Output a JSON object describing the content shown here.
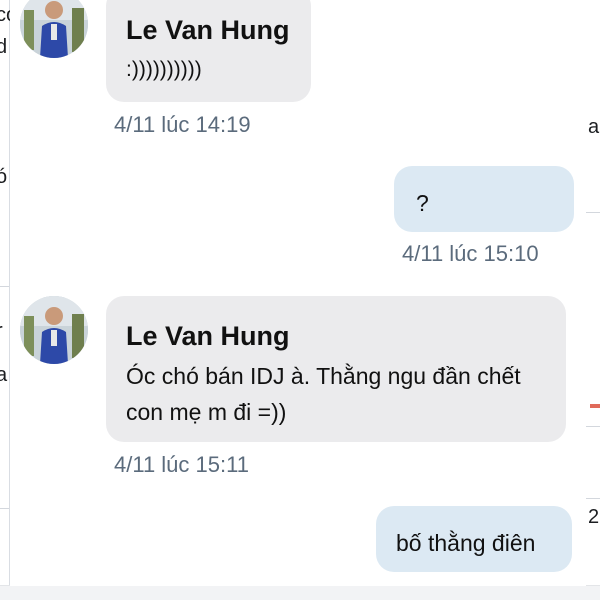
{
  "messages": [
    {
      "direction": "incoming",
      "sender": "Le Van Hung",
      "text": ":))))))))))",
      "time": "4/11 lúc 14:19"
    },
    {
      "direction": "outgoing",
      "text": "?",
      "time": "4/11 lúc 15:10"
    },
    {
      "direction": "incoming",
      "sender": "Le Van Hung",
      "text_lines": [
        "Óc chó bán IDJ à. Thằng ngu đần chết",
        "con mẹ m đi =))"
      ],
      "time": "4/11 lúc 15:11"
    },
    {
      "direction": "outgoing",
      "text": "bố thằng điên"
    }
  ],
  "background": {
    "left_fragments": [
      "co",
      "d",
      "l",
      "ó",
      "r",
      "a"
    ],
    "right_fragments": [
      "a",
      "2"
    ]
  },
  "colors": {
    "incoming_bubble": "#ebebed",
    "outgoing_bubble": "#dce9f3",
    "timestamp": "#5b6b7c",
    "text": "#111111"
  },
  "icons": {
    "avatar": "user-avatar-photo"
  }
}
